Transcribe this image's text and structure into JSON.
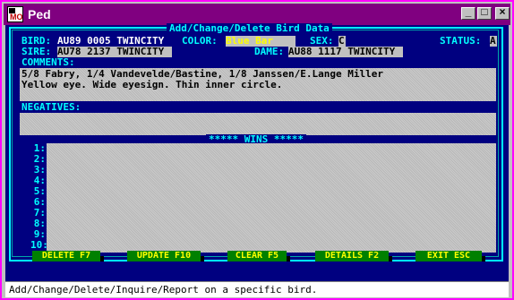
{
  "window": {
    "title": "Ped",
    "icon_text": "MO",
    "controls": [
      "_",
      "□",
      "×"
    ]
  },
  "form": {
    "title": "Add/Change/Delete Bird Data",
    "bird_label": "BIRD:",
    "bird_value": "AU89 0005 TWINCITY",
    "color_label": "COLOR:",
    "color_value": "Blue Bar",
    "sex_label": "SEX:",
    "sex_value": "C",
    "status_label": "STATUS:",
    "status_value": "A",
    "sire_label": "SIRE:",
    "sire_value": "AU78 2137 TWINCITY",
    "dame_label": "DAME:",
    "dame_value": "AU88 1117 TWINCITY",
    "comments_label": "COMMENTS:",
    "comments_lines": [
      "5/8 Fabry, 1/4 Vandevelde/Bastine, 1/8 Janssen/E.Lange Miller",
      "Yellow eye. Wide eyesign. Thin inner circle."
    ],
    "negatives_label": "NEGATIVES:",
    "wins_label": "***** WINS *****",
    "wins_numbers": [
      "1:",
      "2:",
      "3:",
      "4:",
      "5:",
      "6:",
      "7:",
      "8:",
      "9:",
      "10:"
    ]
  },
  "buttons": {
    "delete": "DELETE  F7",
    "update": "UPDATE  F10",
    "clear": "CLEAR  F5",
    "details": "DETAILS  F2",
    "exit": "EXIT  ESC"
  },
  "status_text": "Add/Change/Delete/Inquire/Report on a specific bird.",
  "colors": {
    "background": "#000080",
    "label": "#00ffff",
    "title_bar": "#800080",
    "field": "#c0c0c0",
    "button": "#008000",
    "button_text": "#ffff00",
    "color_highlight": "#ffff00"
  }
}
